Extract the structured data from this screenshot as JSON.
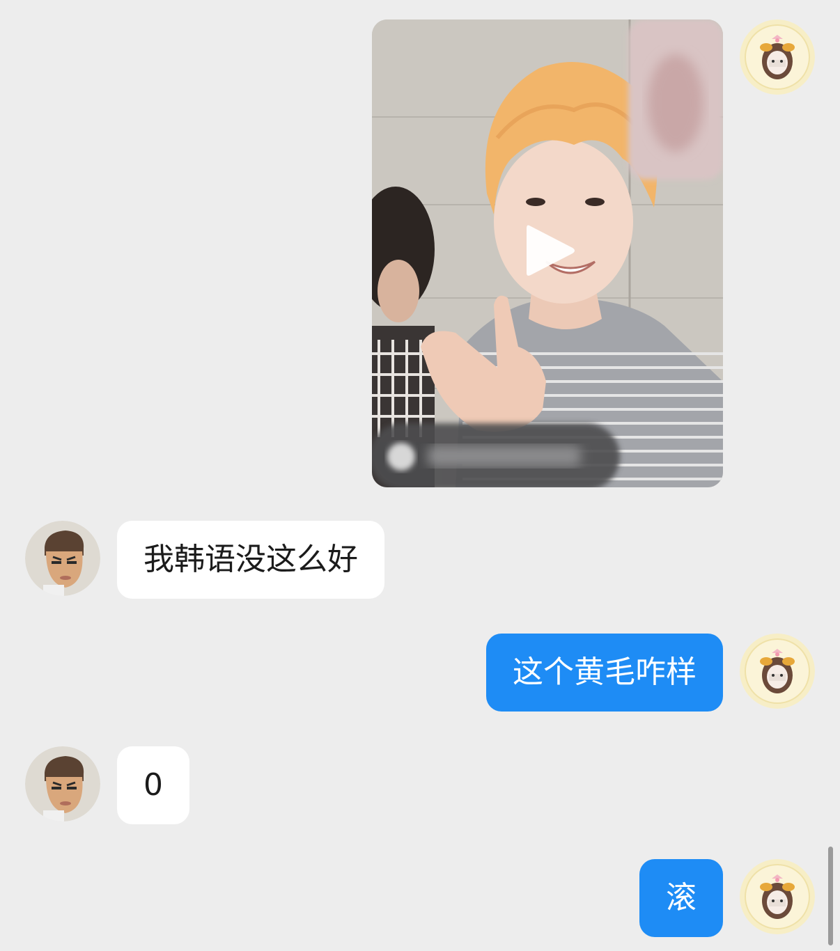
{
  "messages": [
    {
      "id": "m1",
      "sender": "me",
      "type": "video"
    },
    {
      "id": "m2",
      "sender": "other",
      "type": "text",
      "text": "我韩语没这么好"
    },
    {
      "id": "m3",
      "sender": "me",
      "type": "text",
      "text": "这个黄毛咋样"
    },
    {
      "id": "m4",
      "sender": "other",
      "type": "text",
      "text": "0"
    },
    {
      "id": "m5",
      "sender": "me",
      "type": "text",
      "text": "滚"
    }
  ],
  "icons": {
    "play": "play-icon",
    "avatar_me": "cartoon-girl-avatar",
    "avatar_other": "cartoon-man-avatar"
  },
  "colors": {
    "background": "#ededed",
    "outgoing_bubble": "#1e8cf5",
    "incoming_bubble": "#ffffff",
    "outgoing_text": "#ffffff",
    "incoming_text": "#1b1b1b"
  }
}
